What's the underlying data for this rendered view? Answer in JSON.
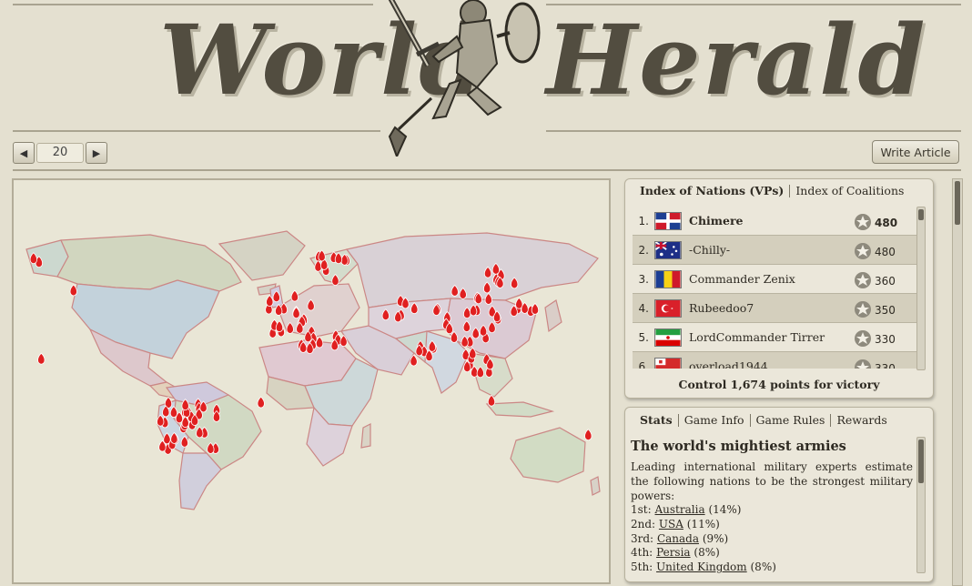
{
  "masthead": {
    "left_word": "World",
    "right_word": "Herald"
  },
  "pager": {
    "prev_icon": "triangle-left-icon",
    "next_icon": "triangle-right-icon",
    "day": "20"
  },
  "toolbar": {
    "write_article": "Write Article"
  },
  "colors": {
    "background": "#e4e0d0",
    "panel": "#ebe7da",
    "ocean": "#e9e6d6",
    "army_marker": "#e02020",
    "text": "#2e2a22"
  },
  "map": {
    "marker_icon": "army-flame-icon"
  },
  "ranking_panel": {
    "tabs": [
      "Index of Nations (VPs)",
      "Index of Coalitions"
    ],
    "nations": [
      {
        "rank": "1.",
        "name": "Chimere",
        "points": "480",
        "flag": "dominican-republic-flag-icon"
      },
      {
        "rank": "2.",
        "name": "-Chilly-",
        "points": "480",
        "flag": "australia-flag-icon"
      },
      {
        "rank": "3.",
        "name": "Commander Zenix",
        "points": "360",
        "flag": "romania-flag-icon"
      },
      {
        "rank": "4.",
        "name": "Rubeedoo7",
        "points": "350",
        "flag": "turkey-flag-icon"
      },
      {
        "rank": "5.",
        "name": "LordCommander Tirrer",
        "points": "330",
        "flag": "iran-flag-icon"
      },
      {
        "rank": "6.",
        "name": "overload1944",
        "points": "330",
        "flag": "red-flag-icon"
      }
    ],
    "victory_text": "Control 1,674 points for victory"
  },
  "info_panel": {
    "tabs": [
      "Stats",
      "Game Info",
      "Game Rules",
      "Rewards"
    ],
    "title": "The world's mightiest armies",
    "intro": "Leading international military experts estimate the following nations to be the strongest military powers:",
    "rankings": [
      {
        "place": "1st:",
        "country": "Australia",
        "pct": "(14%)"
      },
      {
        "place": "2nd:",
        "country": "USA",
        "pct": "(11%)"
      },
      {
        "place": "3rd:",
        "country": "Canada",
        "pct": "(9%)"
      },
      {
        "place": "4th:",
        "country": "Persia",
        "pct": "(8%)"
      },
      {
        "place": "5th:",
        "country": "United Kingdom",
        "pct": "(8%)"
      }
    ]
  }
}
